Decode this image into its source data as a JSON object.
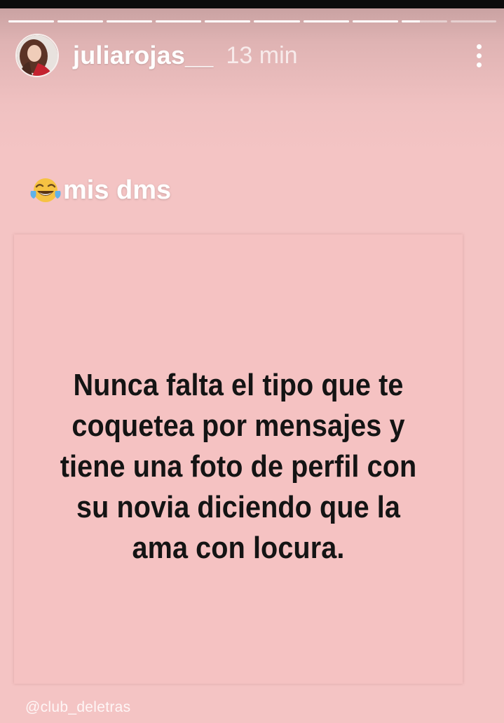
{
  "story": {
    "username": "juliarojas__",
    "time_ago": "13 min",
    "segments_total": 10,
    "segments_viewed": 8,
    "current_segment_progress": 0.4,
    "more_icon": "more-vertical-icon"
  },
  "caption": {
    "emoji_icon": "face-with-tears-of-joy-icon",
    "text": "mis dms"
  },
  "post": {
    "quote": "Nunca falta el tipo que te coquetea por mensajes y tiene una foto de perfil con su novia diciendo que la ama con locura.",
    "background": "#f5c2c2",
    "watermark": "@club_deletras"
  },
  "colors": {
    "story_bg": "#f4c4c4",
    "text_white": "#ffffff",
    "quote_text": "#141414"
  }
}
